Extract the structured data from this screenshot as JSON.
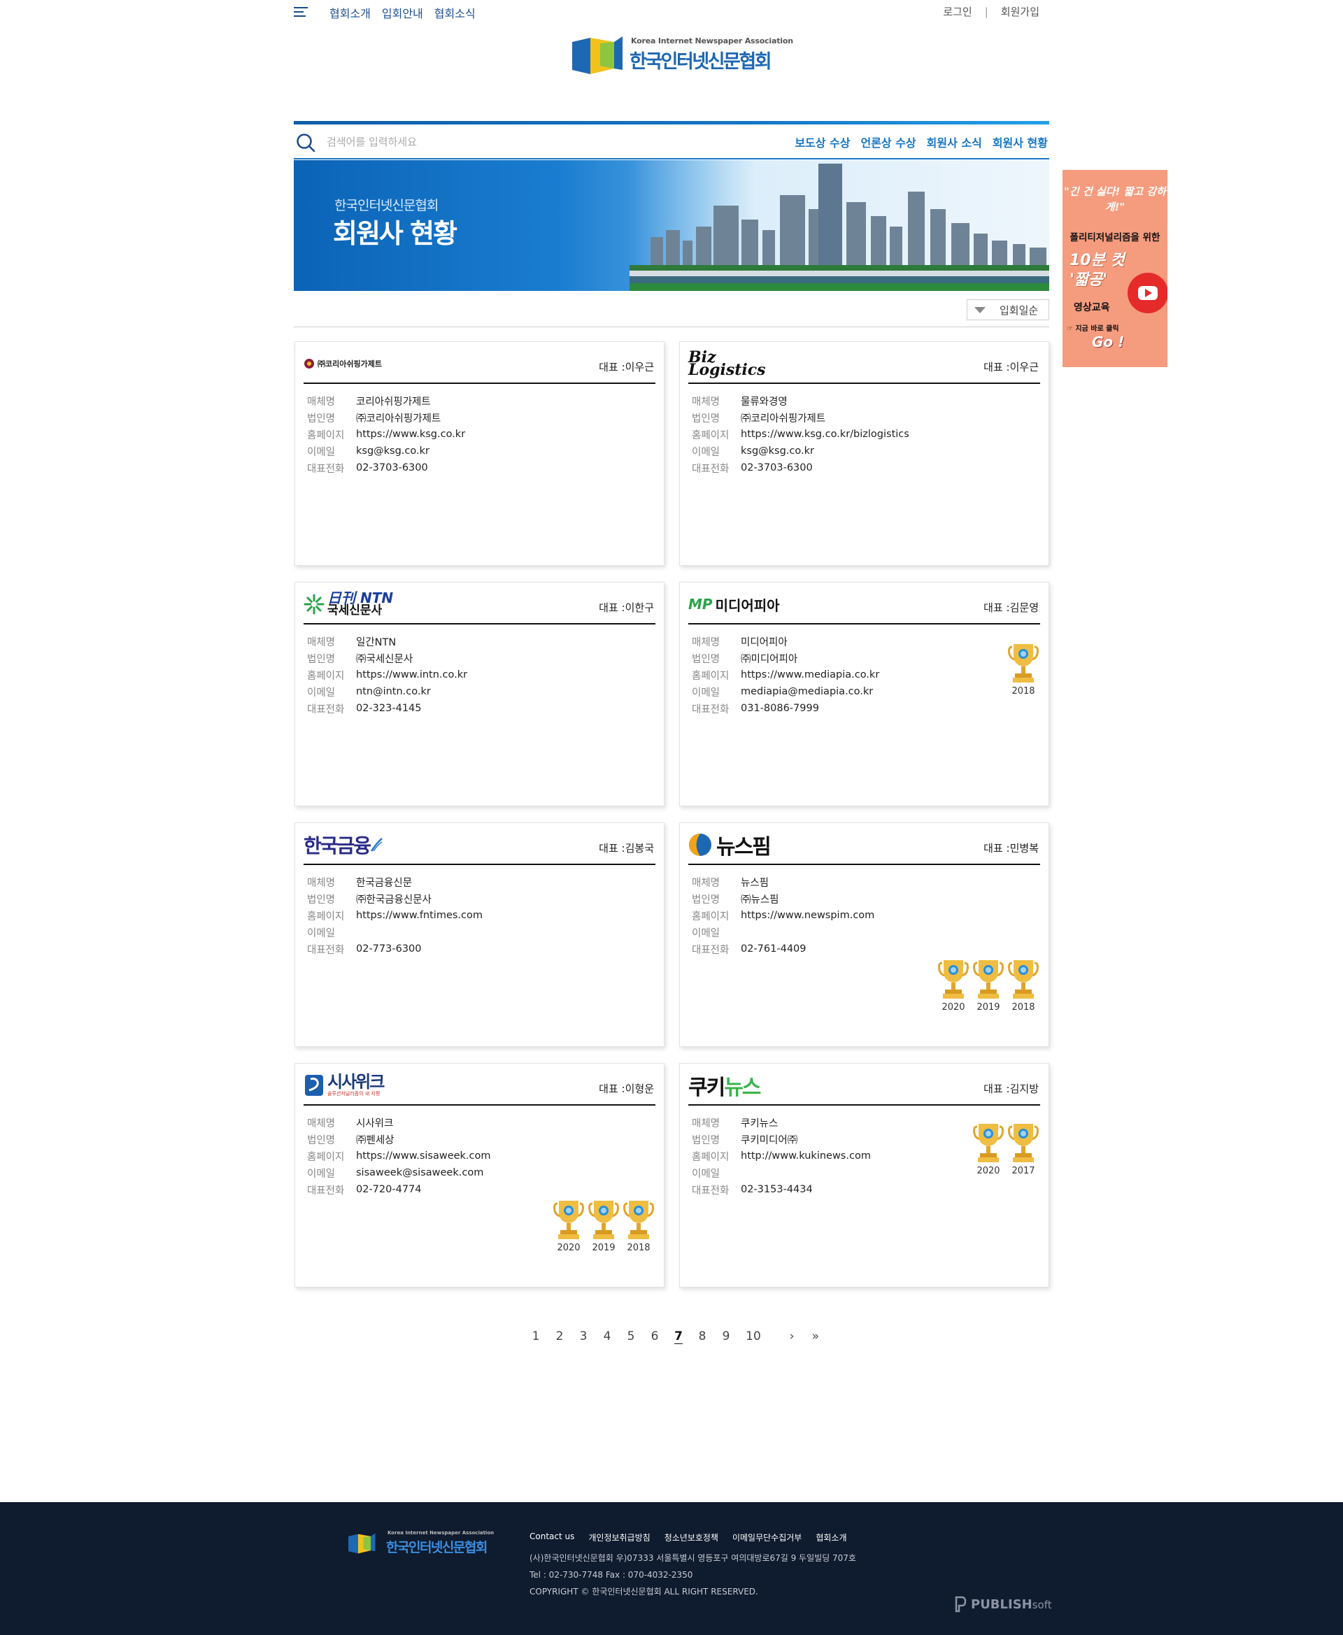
{
  "header": {
    "nav": [
      "협회소개",
      "입회안내",
      "협회소식"
    ],
    "login": "로그인",
    "signup": "회원가입",
    "logo_en": "Korea Internet Newspaper Association",
    "logo_ko": "한국인터넷신문협회"
  },
  "search": {
    "placeholder": "검색어를 입력하세요",
    "links": [
      "보도상 수상",
      "언론상 수상",
      "회원사 소식",
      "회원사 현황"
    ]
  },
  "banner": {
    "subtitle": "한국인터넷신문협회",
    "title": "회원사 현황"
  },
  "sort": {
    "label": "입회일순"
  },
  "field_labels": {
    "media": "매체명",
    "corp": "법인명",
    "homepage": "홈페이지",
    "email": "이메일",
    "phone": "대표전화"
  },
  "members": [
    {
      "logo_text": "㈜코리아쉬핑가제트",
      "rep": "대표 :이우근",
      "media": "코리아쉬핑가제트",
      "corp": "㈜코리아쉬핑가제트",
      "homepage": "https://www.ksg.co.kr",
      "email": "ksg@ksg.co.kr",
      "phone": "02-3703-6300",
      "awards": []
    },
    {
      "logo_text": "Biz Logistics",
      "rep": "대표 :이우근",
      "media": "물류와경영",
      "corp": "㈜코리아쉬핑가제트",
      "homepage": "https://www.ksg.co.kr/bizlogistics",
      "email": "ksg@ksg.co.kr",
      "phone": "02-3703-6300",
      "awards": []
    },
    {
      "logo_text_1": "日刊 NTN",
      "logo_text_2": "국세신문사",
      "rep": "대표 :이한구",
      "media": "일간NTN",
      "corp": "㈜국세신문사",
      "homepage": "https://www.intn.co.kr",
      "email": "ntn@intn.co.kr",
      "phone": "02-323-4145",
      "awards": []
    },
    {
      "logo_text": "미디어피아",
      "rep": "대표 :김문영",
      "media": "미디어피아",
      "corp": "㈜미디어피아",
      "homepage": "https://www.mediapia.co.kr",
      "email": "mediapia@mediapia.co.kr",
      "phone": "031-8086-7999",
      "awards": [
        "2018"
      ]
    },
    {
      "logo_text": "한국금융",
      "rep": "대표 :김봉국",
      "media": "한국금융신문",
      "corp": "㈜한국금융신문사",
      "homepage": "https://www.fntimes.com",
      "email": "",
      "phone": "02-773-6300",
      "awards": []
    },
    {
      "logo_text": "뉴스핌",
      "rep": "대표 :민병복",
      "media": "뉴스핌",
      "corp": "㈜뉴스핌",
      "homepage": "https://www.newspim.com",
      "email": "",
      "phone": "02-761-4409",
      "awards": [
        "2020",
        "2019",
        "2018"
      ]
    },
    {
      "logo_text": "시사위크",
      "logo_sub": "솔루션저널리즘의 새 지평",
      "rep": "대표 :이형운",
      "media": "시사위크",
      "corp": "㈜펜세상",
      "homepage": "https://www.sisaweek.com",
      "email": "sisaweek@sisaweek.com",
      "phone": "02-720-4774",
      "awards": [
        "2020",
        "2019",
        "2018"
      ]
    },
    {
      "logo_text_1": "쿠키",
      "logo_text_2": "뉴스",
      "rep": "대표 :김지방",
      "media": "쿠키뉴스",
      "corp": "쿠키미디어㈜",
      "homepage": "http://www.kukinews.com",
      "email": "",
      "phone": "02-3153-4434",
      "awards": [
        "2020",
        "2017"
      ]
    }
  ],
  "pagination": {
    "pages": [
      "1",
      "2",
      "3",
      "4",
      "5",
      "6",
      "7",
      "8",
      "9",
      "10"
    ],
    "current": "7",
    "next": "›",
    "last": "»"
  },
  "side_ad": {
    "line1": "\"긴 건 싫다! 짧고 강하게!\"",
    "line2": "폴리티저널리즘을 위한",
    "line3a": "10분 컷",
    "line3b": "'짧공'",
    "line4": "영상교육",
    "line5": "☞ 지금 바로 클릭",
    "line6": "Go !"
  },
  "footer": {
    "logo_en": "Korea Internet Newspaper Association",
    "logo_ko": "한국인터넷신문협회",
    "links": [
      "Contact us",
      "개인정보취급방침",
      "청소년보호정책",
      "이메일무단수집거부",
      "협회소개"
    ],
    "address": "(사)한국인터넷신문협회 우)07333 서울특별시 영등포구 여의대방로67길 9 두일빌딩 707호",
    "tel": "Tel : 02-730-7748 Fax : 070-4032-2350",
    "copyright": "COPYRIGHT © 한국인터넷신문협회 ALL RIGHT RESERVED.",
    "brand_bold": "PUBLISH",
    "brand_light": "soft"
  },
  "colors": {
    "primary": "#1675c5",
    "nav": "#1f4f93",
    "footer_bg": "#0f1b2e",
    "ad_bg": "#f59b7e",
    "trophy": "#e8b23a"
  }
}
